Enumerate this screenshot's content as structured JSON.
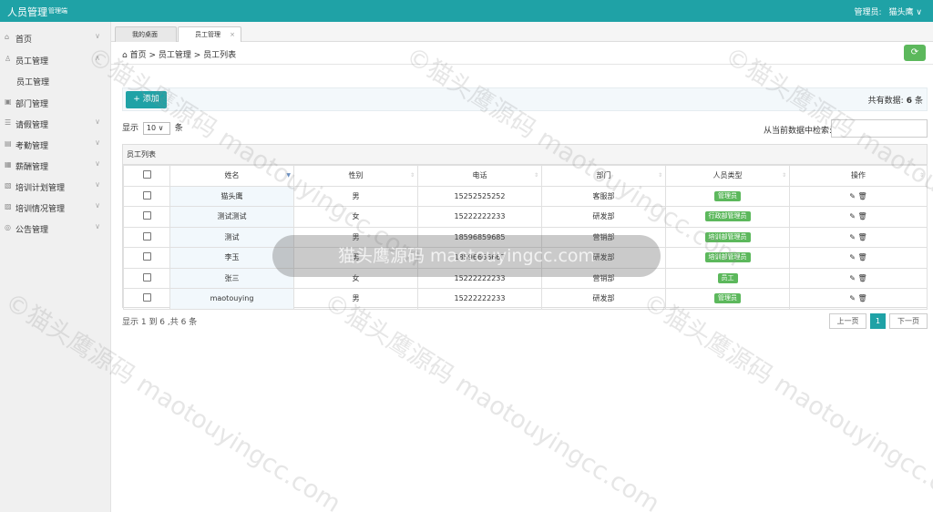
{
  "header": {
    "title": "人员管理",
    "subtitle": "管理端",
    "user_label": "管理员:",
    "user_name": "猫头鹰"
  },
  "sidebar": {
    "items": [
      {
        "label": "首页",
        "icon": "home-icon"
      },
      {
        "label": "员工管理",
        "icon": "user-icon"
      },
      {
        "label": "员工管理",
        "icon": ""
      },
      {
        "label": "部门管理",
        "icon": "department-icon"
      },
      {
        "label": "请假管理",
        "icon": "leave-icon"
      },
      {
        "label": "考勤管理",
        "icon": "attendance-icon"
      },
      {
        "label": "薪酬管理",
        "icon": "salary-icon"
      },
      {
        "label": "培训计划管理",
        "icon": "training-plan-icon"
      },
      {
        "label": "培训情况管理",
        "icon": "training-status-icon"
      },
      {
        "label": "公告管理",
        "icon": "notice-icon"
      }
    ]
  },
  "tabs": [
    {
      "label": "我的桌面"
    },
    {
      "label": "员工管理",
      "close": "×"
    }
  ],
  "breadcrumb": {
    "text": "首页 > 员工管理 > 员工列表"
  },
  "toolbar": {
    "add_label": "+ 添加",
    "total_prefix": "共有数据:",
    "total_count": "6",
    "total_suffix": "条"
  },
  "length": {
    "prefix": "显示",
    "value": "10 ∨",
    "suffix": "条"
  },
  "search": {
    "label": "从当前数据中检索:"
  },
  "table": {
    "caption": "员工列表",
    "headers": [
      "姓名",
      "性别",
      "电话",
      "部门",
      "人员类型",
      "操作"
    ],
    "rows": [
      {
        "name": "猫头鹰",
        "gender": "男",
        "phone": "15252525252",
        "dept": "客服部",
        "type": "管理员"
      },
      {
        "name": "测试测试",
        "gender": "女",
        "phone": "15222222233",
        "dept": "研发部",
        "type": "行政部管理员"
      },
      {
        "name": "测试",
        "gender": "男",
        "phone": "18596859685",
        "dept": "营销部",
        "type": "培训部管理员"
      },
      {
        "name": "李玉",
        "gender": "男",
        "phone": "18596666667",
        "dept": "研发部",
        "type": "培训部管理员"
      },
      {
        "name": "张三",
        "gender": "女",
        "phone": "15222222233",
        "dept": "营销部",
        "type": "员工"
      },
      {
        "name": "maotouying",
        "gender": "男",
        "phone": "15222222233",
        "dept": "研发部",
        "type": "管理员"
      }
    ]
  },
  "pagination": {
    "info": "显示 1 到 6 ,共 6 条",
    "prev": "上一页",
    "current": "1",
    "next": "下一页"
  },
  "watermark": {
    "text": "©猫头鹰源码 maotouyingcc.com",
    "overlay": "猫头鹰源码 maotouyingcc.com"
  },
  "colors": {
    "accent": "#1fa2a6",
    "badge": "#5cb85c"
  }
}
